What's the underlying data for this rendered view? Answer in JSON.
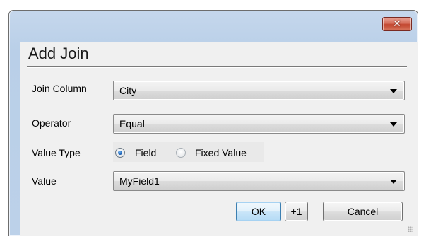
{
  "window": {
    "close_glyph": "✕",
    "close_icon": "close-icon"
  },
  "dialog": {
    "title": "Add Join"
  },
  "form": {
    "join_column": {
      "label": "Join Column",
      "value": "City"
    },
    "operator": {
      "label": "Operator",
      "value": "Equal"
    },
    "value_type": {
      "label": "Value Type",
      "options": [
        {
          "label": "Field",
          "selected": true
        },
        {
          "label": "Fixed Value",
          "selected": false
        }
      ]
    },
    "value": {
      "label": "Value",
      "value": "MyField1"
    }
  },
  "buttons": {
    "ok": "OK",
    "plus_one": "+1",
    "cancel": "Cancel"
  },
  "colors": {
    "frame": "#bcd1e9",
    "client": "#f0f0f0",
    "close_button": "#c1432c",
    "radio_selected": "#1d63b8"
  }
}
